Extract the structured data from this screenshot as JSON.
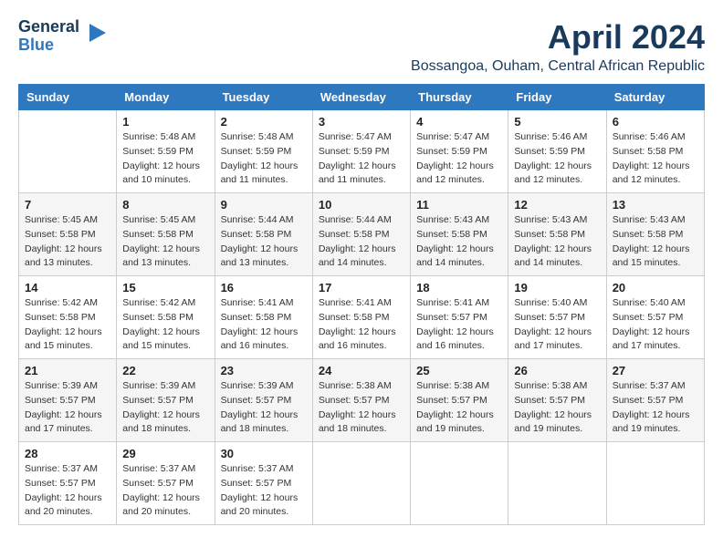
{
  "logo": {
    "line1": "General",
    "line2": "Blue",
    "icon": "▶"
  },
  "header": {
    "month_title": "April 2024",
    "subtitle": "Bossangoa, Ouham, Central African Republic"
  },
  "days_of_week": [
    "Sunday",
    "Monday",
    "Tuesday",
    "Wednesday",
    "Thursday",
    "Friday",
    "Saturday"
  ],
  "weeks": [
    [
      {
        "day": "",
        "info": ""
      },
      {
        "day": "1",
        "info": "Sunrise: 5:48 AM\nSunset: 5:59 PM\nDaylight: 12 hours\nand 10 minutes."
      },
      {
        "day": "2",
        "info": "Sunrise: 5:48 AM\nSunset: 5:59 PM\nDaylight: 12 hours\nand 11 minutes."
      },
      {
        "day": "3",
        "info": "Sunrise: 5:47 AM\nSunset: 5:59 PM\nDaylight: 12 hours\nand 11 minutes."
      },
      {
        "day": "4",
        "info": "Sunrise: 5:47 AM\nSunset: 5:59 PM\nDaylight: 12 hours\nand 12 minutes."
      },
      {
        "day": "5",
        "info": "Sunrise: 5:46 AM\nSunset: 5:59 PM\nDaylight: 12 hours\nand 12 minutes."
      },
      {
        "day": "6",
        "info": "Sunrise: 5:46 AM\nSunset: 5:58 PM\nDaylight: 12 hours\nand 12 minutes."
      }
    ],
    [
      {
        "day": "7",
        "info": "Sunrise: 5:45 AM\nSunset: 5:58 PM\nDaylight: 12 hours\nand 13 minutes."
      },
      {
        "day": "8",
        "info": "Sunrise: 5:45 AM\nSunset: 5:58 PM\nDaylight: 12 hours\nand 13 minutes."
      },
      {
        "day": "9",
        "info": "Sunrise: 5:44 AM\nSunset: 5:58 PM\nDaylight: 12 hours\nand 13 minutes."
      },
      {
        "day": "10",
        "info": "Sunrise: 5:44 AM\nSunset: 5:58 PM\nDaylight: 12 hours\nand 14 minutes."
      },
      {
        "day": "11",
        "info": "Sunrise: 5:43 AM\nSunset: 5:58 PM\nDaylight: 12 hours\nand 14 minutes."
      },
      {
        "day": "12",
        "info": "Sunrise: 5:43 AM\nSunset: 5:58 PM\nDaylight: 12 hours\nand 14 minutes."
      },
      {
        "day": "13",
        "info": "Sunrise: 5:43 AM\nSunset: 5:58 PM\nDaylight: 12 hours\nand 15 minutes."
      }
    ],
    [
      {
        "day": "14",
        "info": "Sunrise: 5:42 AM\nSunset: 5:58 PM\nDaylight: 12 hours\nand 15 minutes."
      },
      {
        "day": "15",
        "info": "Sunrise: 5:42 AM\nSunset: 5:58 PM\nDaylight: 12 hours\nand 15 minutes."
      },
      {
        "day": "16",
        "info": "Sunrise: 5:41 AM\nSunset: 5:58 PM\nDaylight: 12 hours\nand 16 minutes."
      },
      {
        "day": "17",
        "info": "Sunrise: 5:41 AM\nSunset: 5:58 PM\nDaylight: 12 hours\nand 16 minutes."
      },
      {
        "day": "18",
        "info": "Sunrise: 5:41 AM\nSunset: 5:57 PM\nDaylight: 12 hours\nand 16 minutes."
      },
      {
        "day": "19",
        "info": "Sunrise: 5:40 AM\nSunset: 5:57 PM\nDaylight: 12 hours\nand 17 minutes."
      },
      {
        "day": "20",
        "info": "Sunrise: 5:40 AM\nSunset: 5:57 PM\nDaylight: 12 hours\nand 17 minutes."
      }
    ],
    [
      {
        "day": "21",
        "info": "Sunrise: 5:39 AM\nSunset: 5:57 PM\nDaylight: 12 hours\nand 17 minutes."
      },
      {
        "day": "22",
        "info": "Sunrise: 5:39 AM\nSunset: 5:57 PM\nDaylight: 12 hours\nand 18 minutes."
      },
      {
        "day": "23",
        "info": "Sunrise: 5:39 AM\nSunset: 5:57 PM\nDaylight: 12 hours\nand 18 minutes."
      },
      {
        "day": "24",
        "info": "Sunrise: 5:38 AM\nSunset: 5:57 PM\nDaylight: 12 hours\nand 18 minutes."
      },
      {
        "day": "25",
        "info": "Sunrise: 5:38 AM\nSunset: 5:57 PM\nDaylight: 12 hours\nand 19 minutes."
      },
      {
        "day": "26",
        "info": "Sunrise: 5:38 AM\nSunset: 5:57 PM\nDaylight: 12 hours\nand 19 minutes."
      },
      {
        "day": "27",
        "info": "Sunrise: 5:37 AM\nSunset: 5:57 PM\nDaylight: 12 hours\nand 19 minutes."
      }
    ],
    [
      {
        "day": "28",
        "info": "Sunrise: 5:37 AM\nSunset: 5:57 PM\nDaylight: 12 hours\nand 20 minutes."
      },
      {
        "day": "29",
        "info": "Sunrise: 5:37 AM\nSunset: 5:57 PM\nDaylight: 12 hours\nand 20 minutes."
      },
      {
        "day": "30",
        "info": "Sunrise: 5:37 AM\nSunset: 5:57 PM\nDaylight: 12 hours\nand 20 minutes."
      },
      {
        "day": "",
        "info": ""
      },
      {
        "day": "",
        "info": ""
      },
      {
        "day": "",
        "info": ""
      },
      {
        "day": "",
        "info": ""
      }
    ]
  ]
}
